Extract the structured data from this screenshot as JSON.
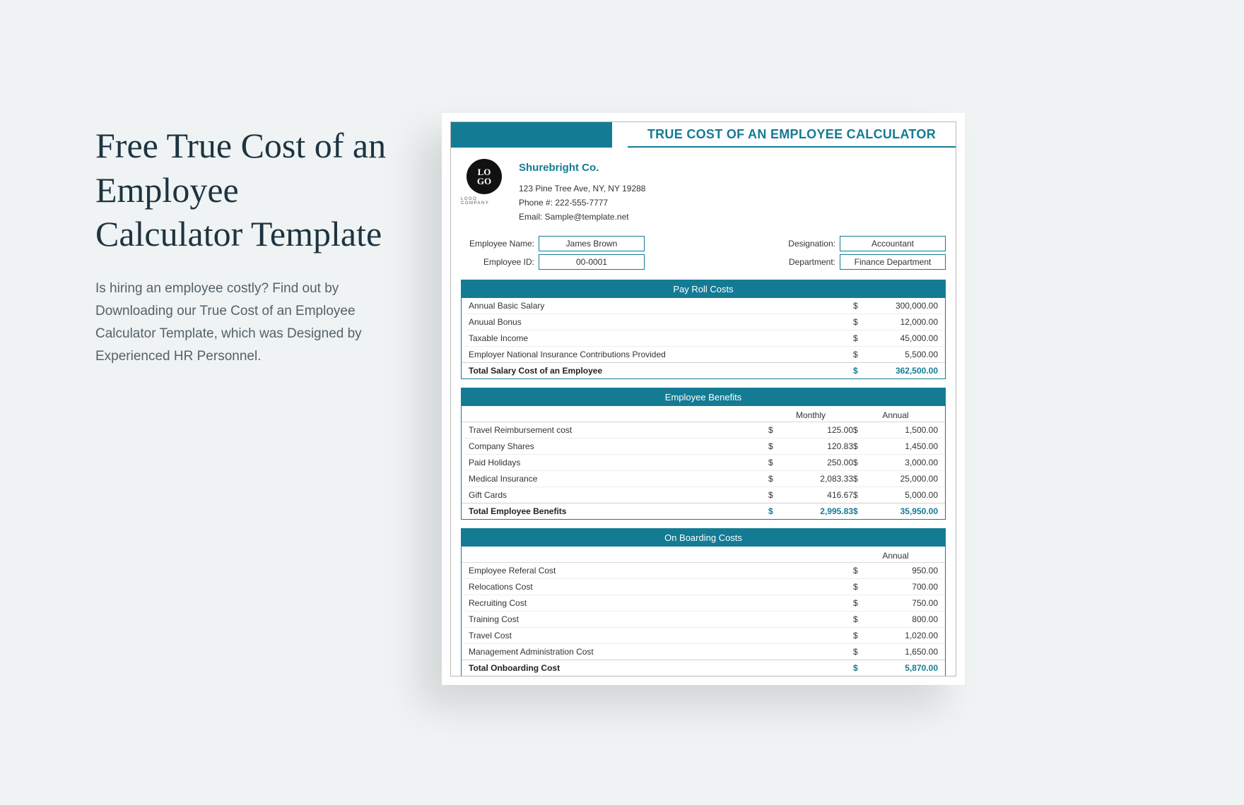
{
  "left": {
    "title": "Free True Cost of an Employee Calculator Template",
    "desc": "Is hiring an employee costly? Find out by Downloading our True Cost of an Employee Calculator Template, which was Designed by Experienced HR Personnel."
  },
  "doc": {
    "header_title": "TRUE COST OF AN EMPLOYEE CALCULATOR",
    "logo_text": "LO\nGO",
    "logo_sub": "LOGO COMPANY",
    "company": {
      "name": "Shurebright Co.",
      "address": "123 Pine Tree Ave, NY, NY  19288",
      "phone": "Phone #: 222-555-7777",
      "email": "Email: Sample@template.net"
    },
    "employee": {
      "name_label": "Employee Name:",
      "name_value": "James Brown",
      "id_label": "Employee ID:",
      "id_value": "00-0001",
      "desig_label": "Designation:",
      "desig_value": "Accountant",
      "dept_label": "Department:",
      "dept_value": "Finance Department"
    },
    "sections": {
      "payroll": {
        "title": "Pay Roll Costs",
        "rows": [
          {
            "label": "Annual Basic Salary",
            "annual": "300,000.00"
          },
          {
            "label": "Anuual Bonus",
            "annual": "12,000.00"
          },
          {
            "label": "Taxable Income",
            "annual": "45,000.00"
          },
          {
            "label": "Employer National Insurance Contributions Provided",
            "annual": "5,500.00"
          }
        ],
        "total_label": "Total Salary Cost of an Employee",
        "total_annual": "362,500.00"
      },
      "benefits": {
        "title": "Employee Benefits",
        "col_monthly": "Monthly",
        "col_annual": "Annual",
        "rows": [
          {
            "label": "Travel Reimbursement cost",
            "monthly": "125.00",
            "annual": "1,500.00"
          },
          {
            "label": "Company Shares",
            "monthly": "120.83",
            "annual": "1,450.00"
          },
          {
            "label": "Paid Holidays",
            "monthly": "250.00",
            "annual": "3,000.00"
          },
          {
            "label": "Medical Insurance",
            "monthly": "2,083.33",
            "annual": "25,000.00"
          },
          {
            "label": "Gift Cards",
            "monthly": "416.67",
            "annual": "5,000.00"
          }
        ],
        "total_label": "Total Employee Benefits",
        "total_monthly": "2,995.83",
        "total_annual": "35,950.00"
      },
      "onboarding": {
        "title": "On Boarding Costs",
        "col_annual": "Annual",
        "rows": [
          {
            "label": "Employee Referal Cost",
            "annual": "950.00"
          },
          {
            "label": "Relocations Cost",
            "annual": "700.00"
          },
          {
            "label": "Recruiting Cost",
            "annual": "750.00"
          },
          {
            "label": "Training Cost",
            "annual": "800.00"
          },
          {
            "label": "Travel Cost",
            "annual": "1,020.00"
          },
          {
            "label": "Management Administration Cost",
            "annual": "1,650.00"
          }
        ],
        "total_label": "Total Onboarding Cost",
        "total_annual": "5,870.00"
      }
    }
  }
}
